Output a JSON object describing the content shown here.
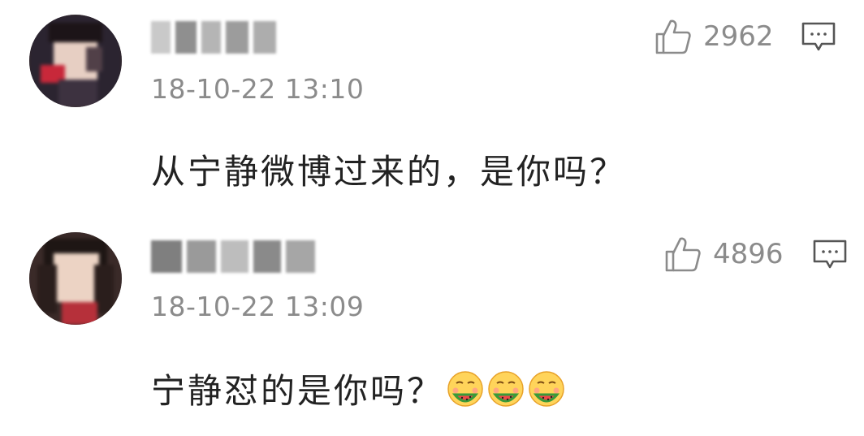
{
  "comments": [
    {
      "username": "",
      "timestamp": "18-10-22 13:10",
      "like_count": "2962",
      "text": "从宁静微博过来的，是你吗？",
      "emoji_count": 0
    },
    {
      "username": "",
      "timestamp": "18-10-22 13:09",
      "like_count": "4896",
      "text": "宁静怼的是你吗？",
      "emoji_count": 3
    }
  ],
  "icons": {
    "like": "thumbs-up-icon",
    "reply": "comment-bubble-icon",
    "emoji": "watermelon-eating-emoji"
  },
  "colors": {
    "meta_text": "#8b8b8b",
    "body_text": "#222222",
    "background": "#ffffff"
  }
}
